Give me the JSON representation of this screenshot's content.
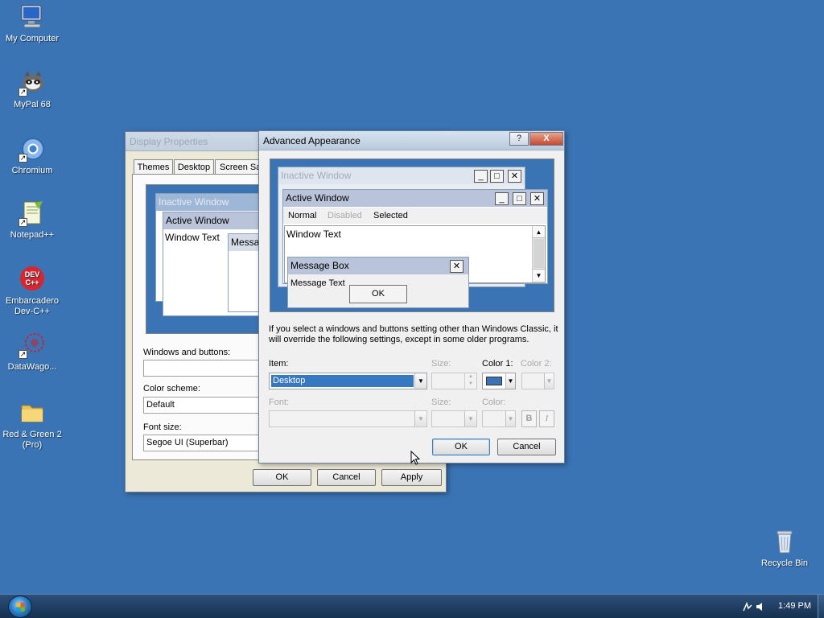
{
  "desktop": {
    "icons": [
      {
        "label": "My Computer",
        "icon": "computer-icon"
      },
      {
        "label": "MyPal 68",
        "icon": "mypal-raccoon-icon"
      },
      {
        "label": "Chromium",
        "icon": "chromium-icon"
      },
      {
        "label": "Notepad++",
        "icon": "notepad-plus-plus-icon"
      },
      {
        "label": "Embarcadero Dev-C++",
        "icon": "dev-cpp-icon",
        "logo_text": "DEV C++"
      },
      {
        "label": "DataWago...",
        "icon": "datawagon-icon"
      },
      {
        "label": "Red & Green 2 (Pro)",
        "icon": "folder-icon"
      },
      {
        "label": "Recycle Bin",
        "icon": "recycle-bin-icon"
      }
    ],
    "background_color": "#3a74b4"
  },
  "taskbar": {
    "clock": "1:49 PM",
    "tray_icons": [
      "network-icon",
      "volume-icon"
    ]
  },
  "display_properties": {
    "title": "Display Properties",
    "tabs": [
      "Themes",
      "Desktop",
      "Screen Sa"
    ],
    "preview": {
      "inactive_window": "Inactive Window",
      "active_window": "Active Window",
      "window_text": "Window Text",
      "message": "Messa"
    },
    "windows_buttons_label": "Windows and buttons:",
    "windows_buttons_value": "",
    "color_scheme_label": "Color scheme:",
    "color_scheme_value": "Default",
    "font_size_label": "Font size:",
    "font_size_value": "Segoe UI (Superbar)",
    "buttons": {
      "ok": "OK",
      "cancel": "Cancel",
      "apply": "Apply"
    }
  },
  "advanced_appearance": {
    "title": "Advanced Appearance",
    "help_button": "?",
    "close_button": "X",
    "preview": {
      "inactive_window": "Inactive Window",
      "active_window": "Active Window",
      "menu": {
        "normal": "Normal",
        "disabled": "Disabled",
        "selected": "Selected"
      },
      "window_text": "Window Text",
      "message_box": "Message Box",
      "message_text": "Message Text",
      "ok": "OK"
    },
    "info_text": "If you select a windows and buttons setting other than Windows Classic, it will override the following settings, except in some older programs.",
    "item_label": "Item:",
    "item_value": "Desktop",
    "size_label": "Size:",
    "color1_label": "Color 1:",
    "color1_value": "#3a74b4",
    "color2_label": "Color 2:",
    "font_label": "Font:",
    "font_size_label": "Size:",
    "font_color_label": "Color:",
    "bold": "B",
    "italic": "I",
    "buttons": {
      "ok": "OK",
      "cancel": "Cancel"
    }
  }
}
